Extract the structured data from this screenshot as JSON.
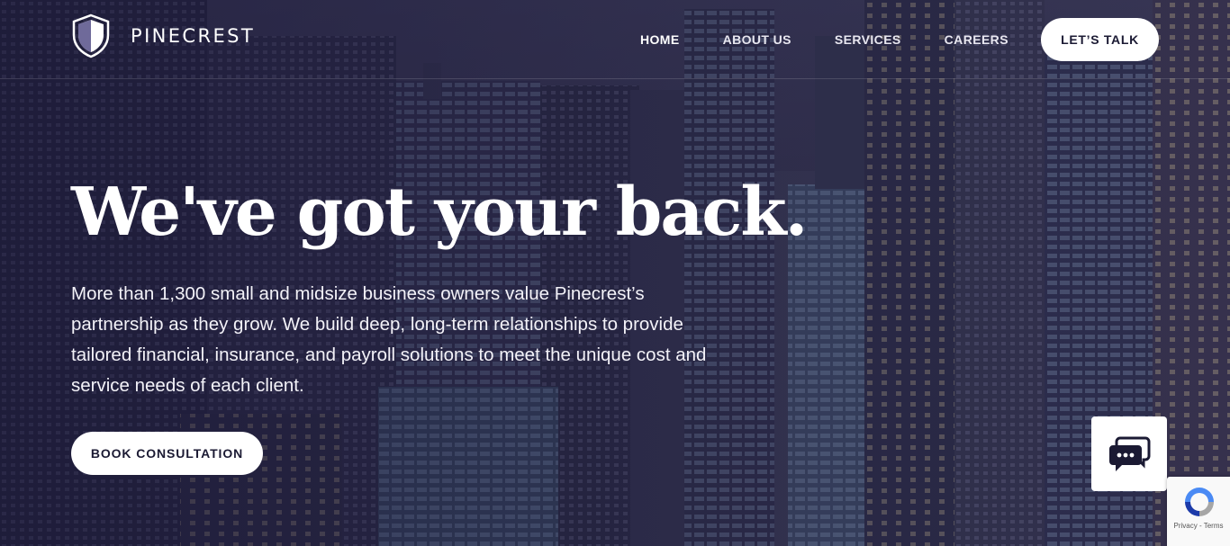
{
  "brand": {
    "name": "PINECREST",
    "logo_icon": "shield-icon"
  },
  "nav": {
    "items": [
      {
        "label": "HOME",
        "active": true
      },
      {
        "label": "ABOUT US",
        "active": false
      },
      {
        "label": "SERVICES",
        "active": false
      },
      {
        "label": "CAREERS",
        "active": false
      }
    ],
    "cta_label": "LET’S TALK"
  },
  "hero": {
    "headline": "We've got your back.",
    "body": "More than 1,300 small and midsize business owners value Pinecrest’s partnership as they grow. We build deep, long-term relationships to provide tailored financial, insurance, and payroll solutions to meet the unique cost and service needs of each client.",
    "button_label": "BOOK CONSULTATION",
    "background": "city-skyline-at-dusk"
  },
  "chat": {
    "icon": "chat-bubbles-icon"
  },
  "recaptcha": {
    "privacy_label": "Privacy",
    "separator": " - ",
    "terms_label": "Terms"
  },
  "colors": {
    "accent_dark": "#1b1a33",
    "overlay": "#2a2747",
    "button_bg": "#ffffff"
  }
}
